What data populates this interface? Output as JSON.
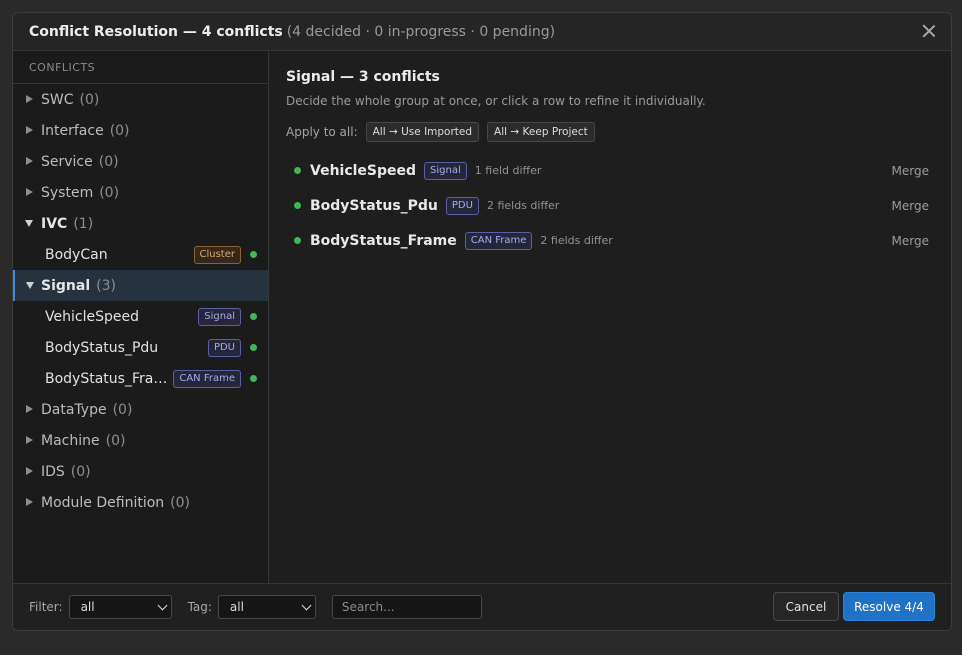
{
  "dialog": {
    "title": "Conflict Resolution — 4 conflicts",
    "subtitle": "(4 decided · 0 in-progress · 0 pending)"
  },
  "sidebar": {
    "header": "CONFLICTS",
    "categories": [
      {
        "name": "SWC",
        "count": "(0)"
      },
      {
        "name": "Interface",
        "count": "(0)"
      },
      {
        "name": "Service",
        "count": "(0)"
      },
      {
        "name": "System",
        "count": "(0)"
      },
      {
        "name": "IVC",
        "count": "(1)",
        "children": [
          {
            "name": "BodyCan",
            "tag": "Cluster",
            "status": "decided"
          }
        ]
      },
      {
        "name": "Signal",
        "count": "(3)",
        "selected": true,
        "children": [
          {
            "name": "VehicleSpeed",
            "tag": "Signal",
            "status": "decided"
          },
          {
            "name": "BodyStatus_Pdu",
            "tag": "PDU",
            "status": "decided"
          },
          {
            "name": "BodyStatus_Frame",
            "display_name": "BodyStatus_Fra…",
            "tag": "CAN Frame",
            "status": "decided"
          }
        ]
      },
      {
        "name": "DataType",
        "count": "(0)"
      },
      {
        "name": "Machine",
        "count": "(0)"
      },
      {
        "name": "IDS",
        "count": "(0)"
      },
      {
        "name": "Module Definition",
        "count": "(0)"
      }
    ]
  },
  "main": {
    "group_title": "Signal — 3 conflicts",
    "group_desc": "Decide the whole group at once, or click a row to refine it individually.",
    "apply_label": "Apply to all:",
    "apply_imported": "All → Use Imported",
    "apply_keep": "All → Keep Project",
    "rows": [
      {
        "name": "VehicleSpeed",
        "tag": "Signal",
        "diff": "1 field differ",
        "action": "Merge"
      },
      {
        "name": "BodyStatus_Pdu",
        "tag": "PDU",
        "diff": "2 fields differ",
        "action": "Merge"
      },
      {
        "name": "BodyStatus_Frame",
        "tag": "CAN Frame",
        "diff": "2 fields differ",
        "action": "Merge"
      }
    ]
  },
  "footer": {
    "filter_label": "Filter:",
    "filter_value": "all",
    "tag_label": "Tag:",
    "tag_value": "all",
    "search_placeholder": "Search...",
    "cancel_label": "Cancel",
    "resolve_label": "Resolve 4/4"
  },
  "colors": {
    "accent": "#1f72c5",
    "decided": "#3fb950",
    "cluster_tag": "#e0a86a",
    "signal_tag": "#a9aaea"
  }
}
